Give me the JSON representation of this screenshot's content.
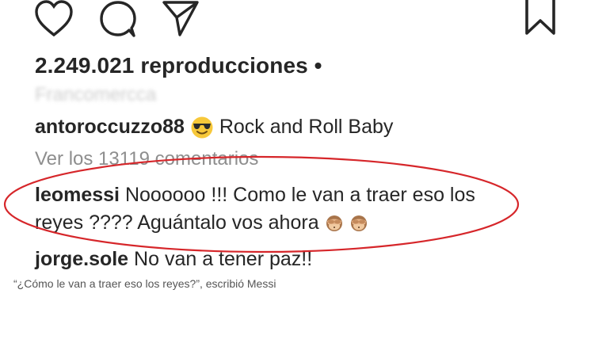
{
  "post": {
    "views": "2.249.021 reproducciones •",
    "faded_line": "Francomercca",
    "caption": {
      "username": "antoroccuzzo88",
      "emoji": "smiling-face-with-sunglasses",
      "text": "Rock and Roll  Baby"
    },
    "view_all_comments": "Ver los 13119 comentarios",
    "comments": [
      {
        "username": "leomessi",
        "text_line1": "Noooooo !!! Como le van a traer eso los",
        "text_line2": "reyes ???? Aguántalo vos ahora",
        "emojis": [
          "see-no-evil-monkey",
          "see-no-evil-monkey"
        ]
      },
      {
        "username": "jorge.sole",
        "text": "No van a tener paz!!"
      }
    ]
  },
  "image_caption": "“¿Cómo le van a traer eso los reyes?”, escribió Messi",
  "colors": {
    "text_primary": "#262626",
    "text_secondary": "#8e8e8e",
    "highlight_ellipse": "#d6262a"
  }
}
